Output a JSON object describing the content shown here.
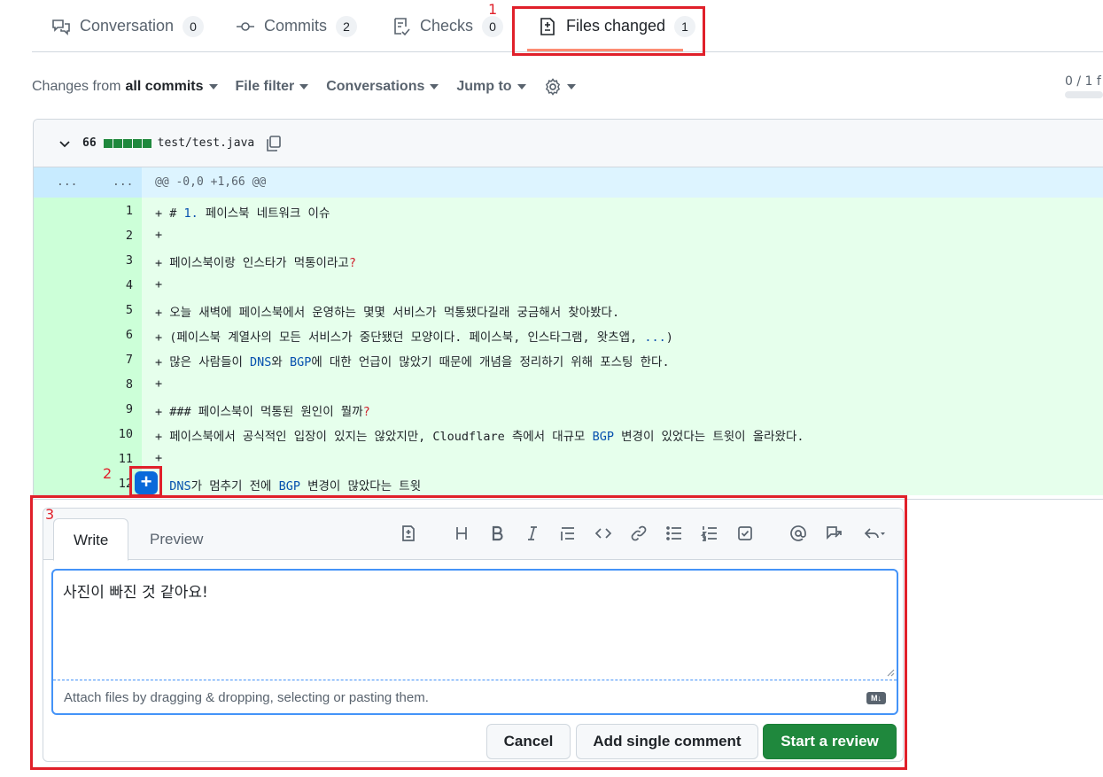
{
  "tabs": [
    {
      "label": "Conversation",
      "count": "0",
      "icon": "comment-discussion-icon"
    },
    {
      "label": "Commits",
      "count": "2",
      "icon": "git-commit-icon"
    },
    {
      "label": "Checks",
      "count": "0",
      "icon": "checklist-icon"
    },
    {
      "label": "Files changed",
      "count": "1",
      "icon": "file-diff-icon",
      "active": true
    }
  ],
  "annotations": {
    "one": "1",
    "two": "2",
    "three": "3",
    "color": "#e0202a"
  },
  "toolbar": {
    "changes_prefix": "Changes from",
    "changes_value": "all commits",
    "file_filter": "File filter",
    "conversations": "Conversations",
    "jump_to": "Jump to",
    "settings_icon": "gear-icon",
    "viewed_progress": "0 / 1 f"
  },
  "file": {
    "changes_count": "66",
    "path": "test/test.java",
    "hunk_left": "...",
    "hunk_right": "...",
    "hunk_header": "@@ -0,0 +1,66 @@",
    "lines": [
      {
        "n": "1",
        "text": "+ # 1. 페이스북 네트워크 이슈"
      },
      {
        "n": "2",
        "text": "+"
      },
      {
        "n": "3",
        "text": "+ 페이스북이랑 인스타가 먹통이라고?"
      },
      {
        "n": "4",
        "text": "+"
      },
      {
        "n": "5",
        "text": "+ 오늘 새벽에 페이스북에서 운영하는 몇몇 서비스가 먹통됐다길래 궁금해서 찾아봤다."
      },
      {
        "n": "6",
        "text": "+ (페이스북 계열사의 모든 서비스가 중단됐던 모양이다. 페이스북, 인스타그램, 왓츠앱, ...)"
      },
      {
        "n": "7",
        "text": "+ 많은 사람들이 DNS와 BGP에 대한 언급이 많았기 때문에 개념을 정리하기 위해 포스팅 한다."
      },
      {
        "n": "8",
        "text": "+"
      },
      {
        "n": "9",
        "text": "+ ### 페이스북이 먹통된 원인이 뭘까?"
      },
      {
        "n": "10",
        "text": "+ 페이스북에서 공식적인 입장이 있지는 않았지만, Cloudflare 측에서 대규모 BGP 변경이 있었다는 트윗이 올라왔다."
      },
      {
        "n": "11",
        "text": "+"
      },
      {
        "n": "12",
        "text": "  DNS가 멈추기 전에 BGP 변경이 많았다는 트윗"
      }
    ]
  },
  "comment": {
    "tab_write": "Write",
    "tab_preview": "Preview",
    "text": "사진이 빠진 것 같아요!",
    "attach_hint": "Attach files by dragging & dropping, selecting or pasting them.",
    "markdown_badge": "M↓",
    "cancel": "Cancel",
    "add_single": "Add single comment",
    "start_review": "Start a review"
  }
}
